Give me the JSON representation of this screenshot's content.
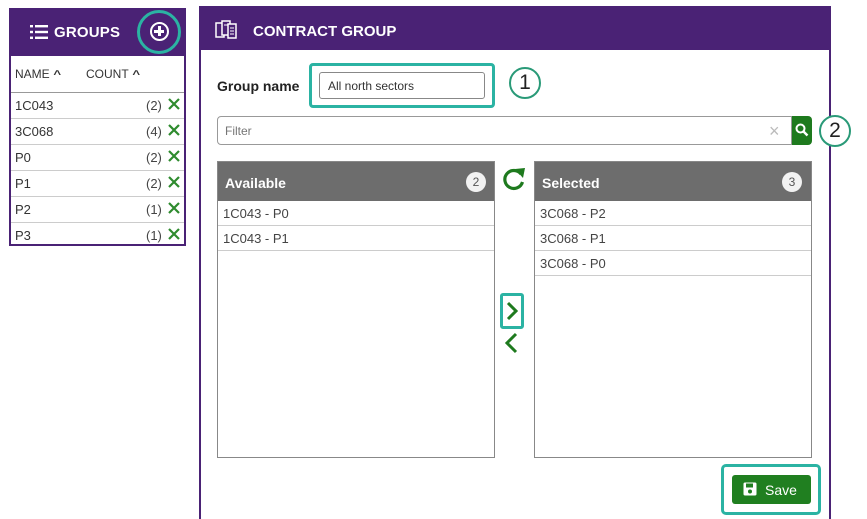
{
  "groups_panel": {
    "title": "GROUPS",
    "columns": {
      "name": "NAME",
      "count": "COUNT"
    },
    "rows": [
      {
        "name": "1C043",
        "count": "(2)"
      },
      {
        "name": "3C068",
        "count": "(4)"
      },
      {
        "name": "P0",
        "count": "(2)"
      },
      {
        "name": "P1",
        "count": "(2)"
      },
      {
        "name": "P2",
        "count": "(1)"
      },
      {
        "name": "P3",
        "count": "(1)"
      }
    ]
  },
  "contract_panel": {
    "title": "CONTRACT GROUP",
    "group_name_label": "Group name",
    "group_name_value": "All north sectors",
    "filter_placeholder": "Filter",
    "available": {
      "title": "Available",
      "count": "2",
      "items": [
        "1C043 - P0",
        "1C043 - P1"
      ]
    },
    "selected": {
      "title": "Selected",
      "count": "3",
      "items": [
        "3C068 - P2",
        "3C068 - P1",
        "3C068 - P0"
      ]
    },
    "save_label": "Save"
  },
  "callouts": [
    "1",
    "2"
  ],
  "colors": {
    "header": "#4a2275",
    "accent_green": "#207f20",
    "highlight": "#2bb3a3",
    "list_header": "#6d6d6d"
  },
  "icons": [
    "list-icon",
    "add-circle-icon",
    "delete-x-icon",
    "document-icon",
    "search-icon",
    "clear-icon",
    "refresh-icon",
    "chevron-right-icon",
    "chevron-left-icon",
    "save-icon"
  ]
}
